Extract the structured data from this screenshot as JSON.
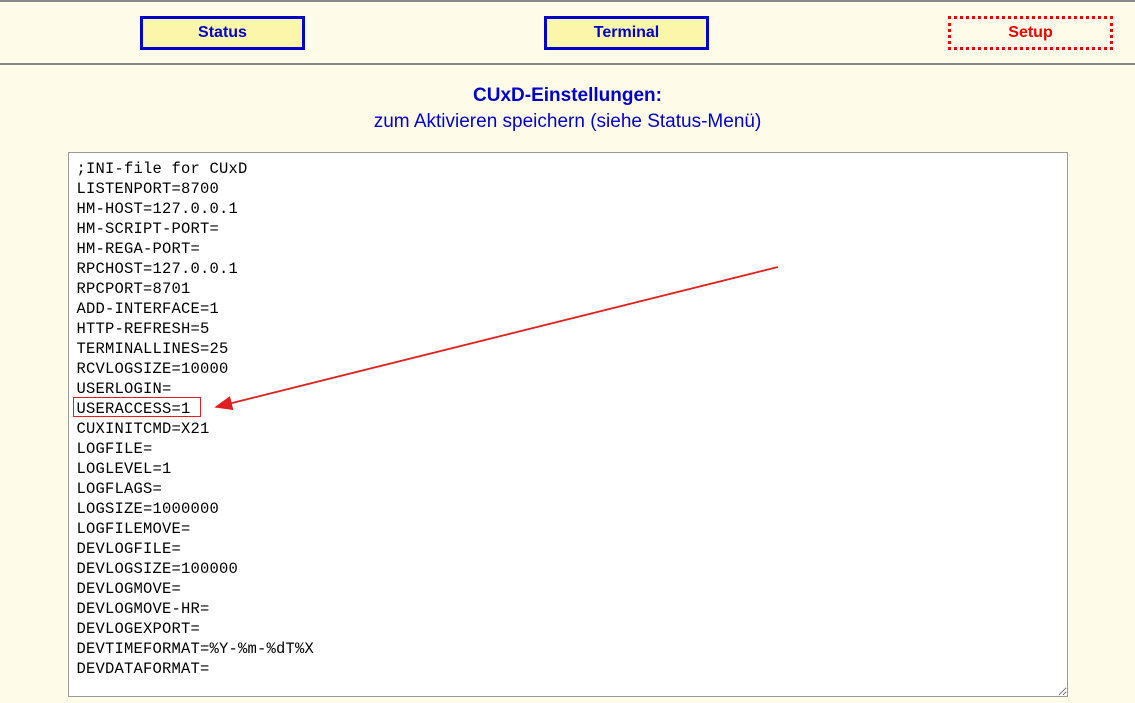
{
  "nav": {
    "status_label": "Status",
    "terminal_label": "Terminal",
    "setup_label": "Setup"
  },
  "heading": {
    "title": "CUxD-Einstellungen:",
    "subtitle": "zum Aktivieren speichern (siehe Status-Menü)"
  },
  "editor_content": ";INI-file for CUxD\nLISTENPORT=8700\nHM-HOST=127.0.0.1\nHM-SCRIPT-PORT=\nHM-REGA-PORT=\nRPCHOST=127.0.0.1\nRPCPORT=8701\nADD-INTERFACE=1\nHTTP-REFRESH=5\nTERMINALLINES=25\nRCVLOGSIZE=10000\nUSERLOGIN=\nUSERACCESS=1\nCUXINITCMD=X21\nLOGFILE=\nLOGLEVEL=1\nLOGFLAGS=\nLOGSIZE=1000000\nLOGFILEMOVE=\nDEVLOGFILE=\nDEVLOGSIZE=100000\nDEVLOGMOVE=\nDEVLOGMOVE-HR=\nDEVLOGEXPORT=\nDEVTIMEFORMAT=%Y-%m-%dT%X\nDEVDATAFORMAT=\n",
  "annotation": {
    "highlighted_line": "USERACCESS=1"
  }
}
